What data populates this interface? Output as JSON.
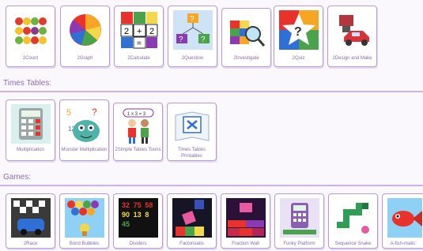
{
  "top_row": [
    {
      "label": "2Count",
      "icon": "fruit-count-icon"
    },
    {
      "label": "2Graph",
      "icon": "pie-chart-icon"
    },
    {
      "label": "2Calculate",
      "icon": "calculator-grid-icon"
    },
    {
      "label": "2Question",
      "icon": "question-flow-icon"
    },
    {
      "label": "2Investigate",
      "icon": "magnifier-blocks-icon"
    },
    {
      "label": "2Quiz",
      "icon": "quiz-star-icon"
    },
    {
      "label": "2Design and Make",
      "icon": "vehicle-design-icon"
    }
  ],
  "times_tables": {
    "title": "Times Tables:",
    "items": [
      {
        "label": "Multiplication",
        "icon": "calculator-icon"
      },
      {
        "label": "Monster Multiplication",
        "icon": "monster-icon"
      },
      {
        "label": "2Simple Tables Toons",
        "icon": "kids-toons-icon"
      },
      {
        "label": "Times Tables Printables",
        "icon": "printable-times-icon"
      }
    ]
  },
  "games": {
    "title": "Games:",
    "items": [
      {
        "label": "2Race",
        "icon": "race-car-icon"
      },
      {
        "label": "Bond Bubbles",
        "icon": "bubbles-icon"
      },
      {
        "label": "Dividers",
        "icon": "number-grid-icon"
      },
      {
        "label": "Factorisatis",
        "icon": "falling-blocks-icon"
      },
      {
        "label": "Fraction Wall",
        "icon": "fraction-wall-icon"
      },
      {
        "label": "Funky Platform",
        "icon": "platform-calculator-icon"
      },
      {
        "label": "Sequence Snake",
        "icon": "snake-icon"
      },
      {
        "label": "A-fish-matic",
        "icon": "fish-icon"
      }
    ],
    "grid_numbers": [
      "32",
      "75",
      "58",
      "90",
      "13",
      "8",
      "45",
      "",
      ""
    ]
  }
}
